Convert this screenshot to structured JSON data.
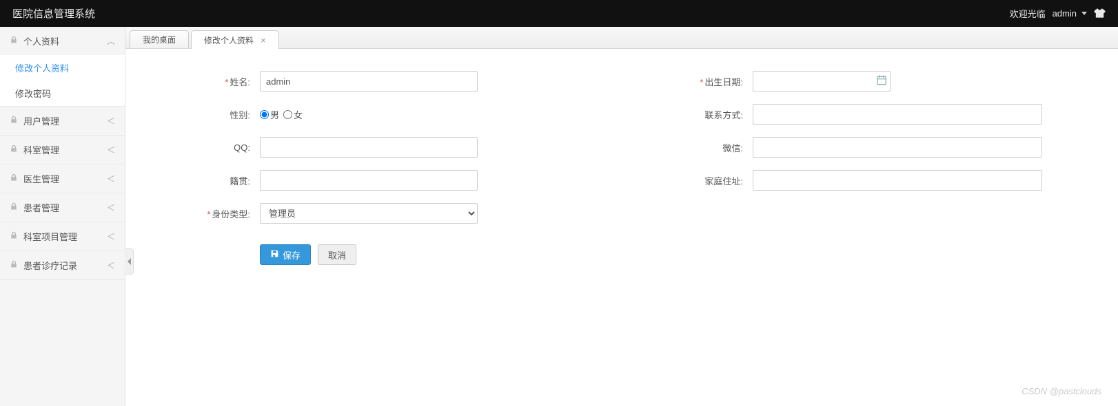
{
  "header": {
    "title": "医院信息管理系统",
    "welcome": "欢迎光临",
    "username": "admin"
  },
  "sidebar": {
    "groups": [
      {
        "label": "个人资料",
        "expanded": true,
        "children": [
          {
            "label": "修改个人资料",
            "active": true
          },
          {
            "label": "修改密码",
            "active": false
          }
        ]
      },
      {
        "label": "用户管理",
        "expanded": false
      },
      {
        "label": "科室管理",
        "expanded": false
      },
      {
        "label": "医生管理",
        "expanded": false
      },
      {
        "label": "患者管理",
        "expanded": false
      },
      {
        "label": "科室项目管理",
        "expanded": false
      },
      {
        "label": "患者诊疗记录",
        "expanded": false
      }
    ]
  },
  "tabs": [
    {
      "label": "我的桌面",
      "closable": false,
      "active": false
    },
    {
      "label": "修改个人资料",
      "closable": true,
      "active": true
    }
  ],
  "form": {
    "name_label": "姓名:",
    "name_value": "admin",
    "birthdate_label": "出生日期:",
    "birthdate_value": "",
    "gender_label": "性别:",
    "gender_male": "男",
    "gender_female": "女",
    "gender_selected": "male",
    "contact_label": "联系方式:",
    "contact_value": "",
    "qq_label": "QQ:",
    "qq_value": "",
    "wechat_label": "微信:",
    "wechat_value": "",
    "origin_label": "籍贯:",
    "origin_value": "",
    "address_label": "家庭住址:",
    "address_value": "",
    "identity_label": "身份类型:",
    "identity_value": "管理员",
    "save_label": "保存",
    "cancel_label": "取消"
  },
  "watermark": "CSDN @pastclouds"
}
